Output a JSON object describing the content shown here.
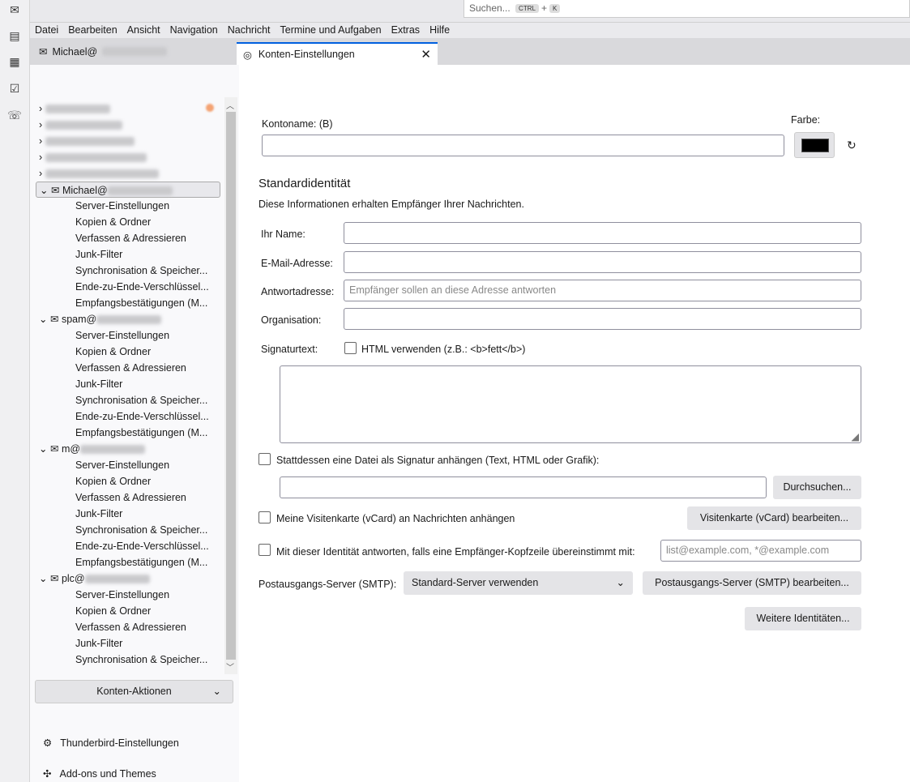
{
  "spaces": [
    "mail-icon",
    "address-book-icon",
    "calendar-icon",
    "tasks-icon",
    "chat-icon"
  ],
  "search": {
    "placeholder": "Suchen...",
    "key1": "CTRL",
    "plus": "+",
    "key2": "K"
  },
  "menu": [
    "Datei",
    "Bearbeiten",
    "Ansicht",
    "Navigation",
    "Nachricht",
    "Termine und Aufgaben",
    "Extras",
    "Hilfe"
  ],
  "tabs": {
    "mail": "Michael@",
    "settings": "Konten-Einstellungen",
    "close": "✕"
  },
  "tree": {
    "accounts": [
      {
        "name": "Michael@",
        "items": [
          "Server-Einstellungen",
          "Kopien & Ordner",
          "Verfassen & Adressieren",
          "Junk-Filter",
          "Synchronisation & Speicher...",
          "Ende-zu-Ende-Verschlüssel...",
          "Empfangsbestätigungen (M..."
        ]
      },
      {
        "name": "spam@",
        "items": [
          "Server-Einstellungen",
          "Kopien & Ordner",
          "Verfassen & Adressieren",
          "Junk-Filter",
          "Synchronisation & Speicher...",
          "Ende-zu-Ende-Verschlüssel...",
          "Empfangsbestätigungen (M..."
        ]
      },
      {
        "name": "m@",
        "items": [
          "Server-Einstellungen",
          "Kopien & Ordner",
          "Verfassen & Adressieren",
          "Junk-Filter",
          "Synchronisation & Speicher...",
          "Ende-zu-Ende-Verschlüssel...",
          "Empfangsbestätigungen (M..."
        ]
      },
      {
        "name": "plc@",
        "items": [
          "Server-Einstellungen",
          "Kopien & Ordner",
          "Verfassen & Adressieren",
          "Junk-Filter",
          "Synchronisation & Speicher..."
        ]
      }
    ]
  },
  "sidebar": {
    "account_actions": "Konten-Aktionen",
    "settings": "Thunderbird-Einstellungen",
    "addons": "Add-ons und Themes"
  },
  "form": {
    "account_name_label": "Kontoname: (B)",
    "color_label": "Farbe:",
    "color": "#000000",
    "section_title": "Standardidentität",
    "section_desc": "Diese Informationen erhalten Empfänger Ihrer Nachrichten.",
    "name_label": "Ihr Name:",
    "email_label": "E-Mail-Adresse:",
    "reply_label": "Antwortadresse:",
    "reply_placeholder": "Empfänger sollen an diese Adresse antworten",
    "org_label": "Organisation:",
    "sig_label": "Signaturtext:",
    "html_label": "HTML verwenden (z.B.: <b>fett</b>)",
    "attach_sig_label": "Stattdessen eine Datei als Signatur anhängen (Text, HTML oder Grafik):",
    "browse": "Durchsuchen...",
    "vcard_label": "Meine Visitenkarte (vCard) an Nachrichten anhängen",
    "vcard_edit": "Visitenkarte (vCard) bearbeiten...",
    "catchall_label": "Mit dieser Identität antworten, falls eine Empfänger-Kopfzeile übereinstimmt mit:",
    "catchall_placeholder": "list@example.com, *@example.com",
    "smtp_label": "Postausgangs-Server (SMTP):",
    "smtp_value": "Standard-Server verwenden",
    "smtp_edit": "Postausgangs-Server (SMTP) bearbeiten...",
    "more_identities": "Weitere Identitäten..."
  }
}
